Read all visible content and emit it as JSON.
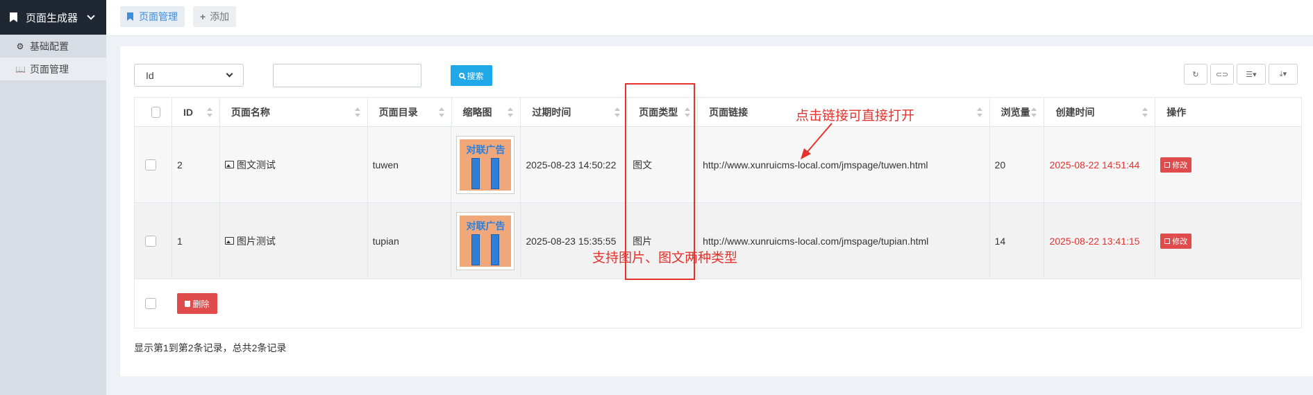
{
  "sidebar": {
    "header": "页面生成器",
    "items": [
      {
        "label": "基础配置",
        "icon": "gear-icon"
      },
      {
        "label": "页面管理",
        "icon": "book-icon"
      }
    ]
  },
  "tabs": [
    {
      "label": "页面管理",
      "icon": "bookmark-icon"
    },
    {
      "label": "添加",
      "icon": "plus-icon"
    }
  ],
  "filter": {
    "field": "Id",
    "search_value": "",
    "search_label": "搜索"
  },
  "table": {
    "columns": [
      "ID",
      "页面名称",
      "页面目录",
      "缩略图",
      "过期时间",
      "页面类型",
      "页面链接",
      "浏览量",
      "创建时间",
      "操作"
    ],
    "rows": [
      {
        "id": "2",
        "name": "图文测试",
        "dir": "tuwen",
        "thumb_text": "对联广告",
        "expire": "2025-08-23 14:50:22",
        "type": "图文",
        "link": "http://www.xunruicms-local.com/jmspage/tuwen.html",
        "views": "20",
        "created": "2025-08-22 14:51:44",
        "action": "修改"
      },
      {
        "id": "1",
        "name": "图片测试",
        "dir": "tupian",
        "thumb_text": "对联广告",
        "expire": "2025-08-23 15:35:55",
        "type": "图片",
        "link": "http://www.xunruicms-local.com/jmspage/tupian.html",
        "views": "14",
        "created": "2025-08-22 13:41:15",
        "action": "修改"
      }
    ],
    "delete_label": "删除"
  },
  "annotations": {
    "link_note": "点击链接可直接打开",
    "type_note": "支持图片、图文两种类型"
  },
  "pagination": {
    "info": "显示第1到第2条记录，总共2条记录"
  },
  "colors": {
    "accent": "#20a8e8",
    "danger": "#e04b4b",
    "annotation": "#e5322d",
    "sidebar_header": "#1f2733"
  }
}
